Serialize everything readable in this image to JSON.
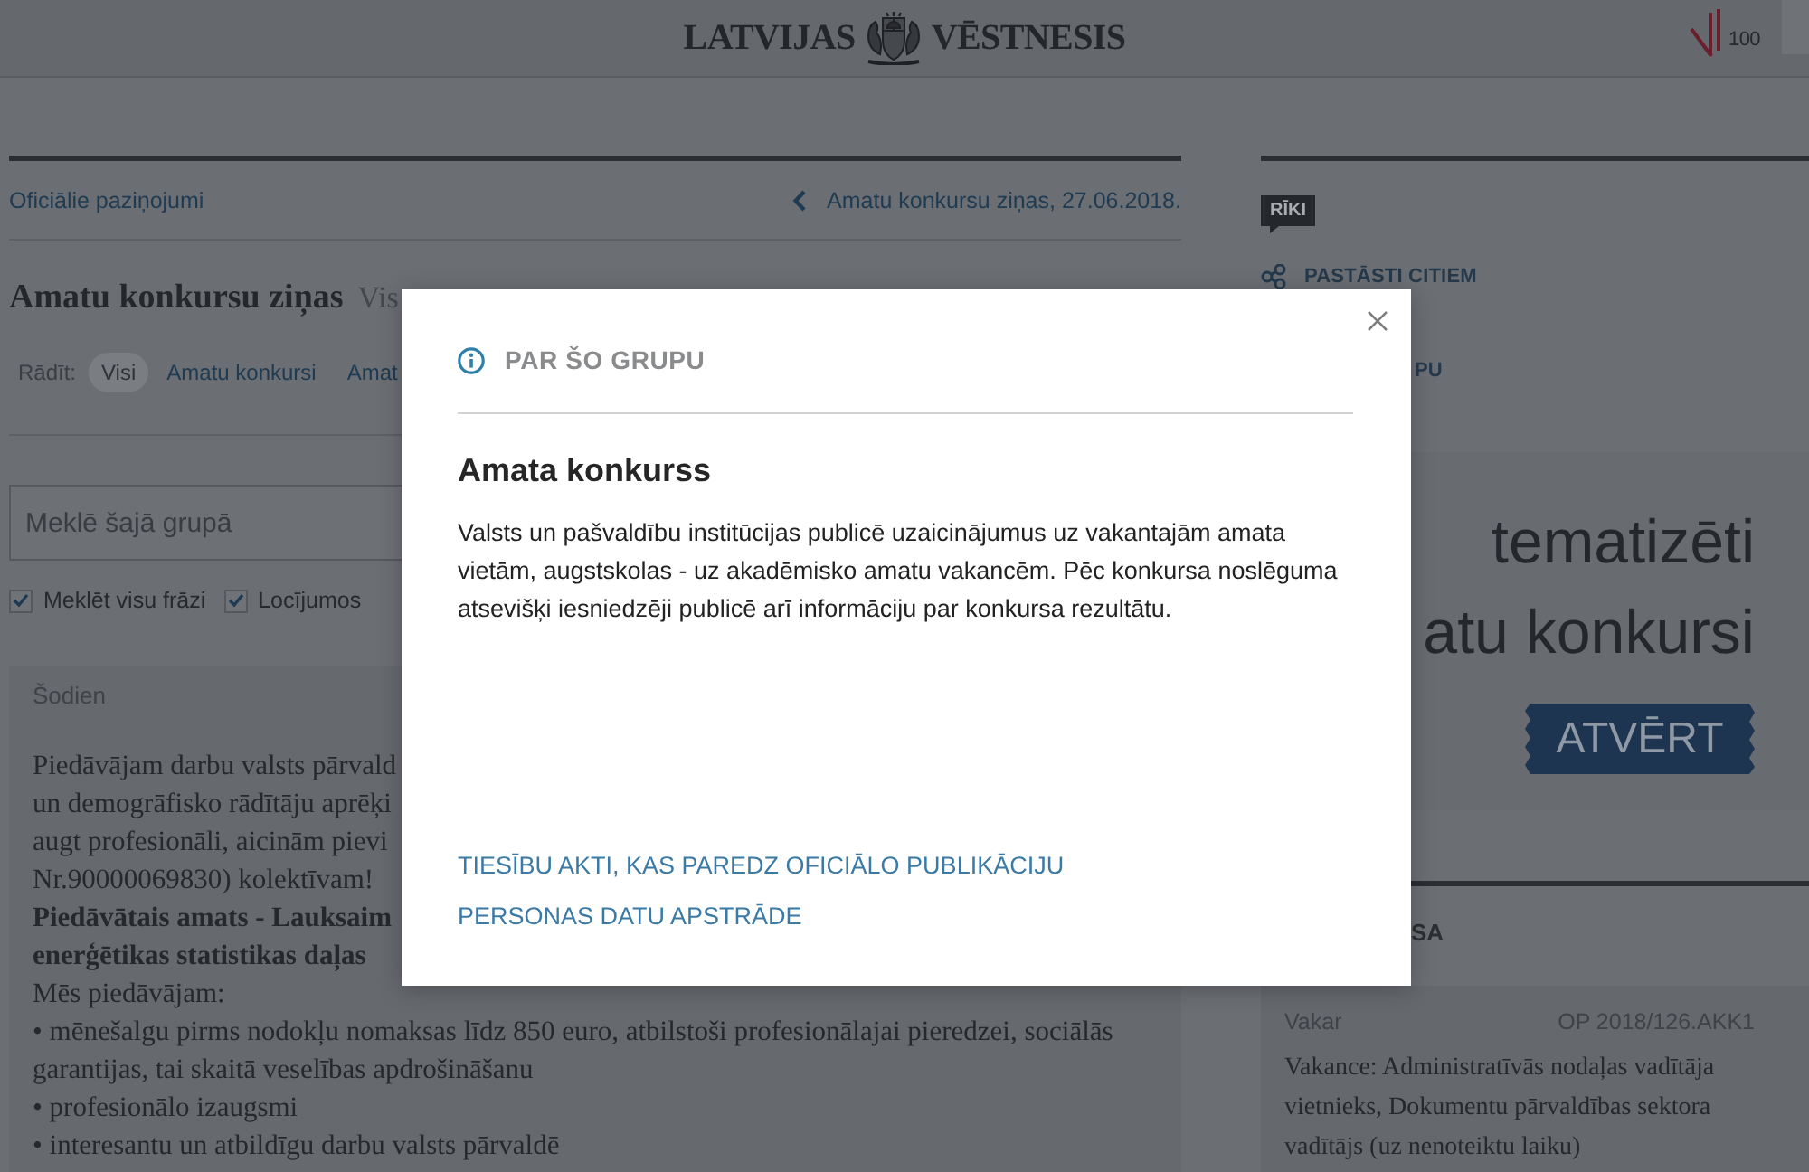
{
  "header": {
    "logo_left": "LATVIJAS",
    "logo_right": "VĒSTNESIS",
    "badge": "100"
  },
  "breadcrumb": {
    "section": "Oficiālie paziņojumi",
    "previous": "Amatu konkursu ziņas, 27.06.2018."
  },
  "group": {
    "title": "Amatu konkursu ziņas",
    "subtitle": "Vis"
  },
  "filter": {
    "label": "Rādīt:",
    "options": [
      {
        "label": "Visi",
        "selected": true
      },
      {
        "label": "Amatu konkursi",
        "selected": false
      },
      {
        "label": "Amat",
        "selected": false
      }
    ]
  },
  "search": {
    "placeholder": "Meklē šajā grupā",
    "options": [
      {
        "label": "Meklēt visu frāzi",
        "checked": true
      },
      {
        "label": "Locījumos",
        "checked": true
      }
    ]
  },
  "feed": {
    "date": "Šodien",
    "lines": [
      {
        "kind": "text",
        "text": "Piedāvājam darbu valsts pārvald"
      },
      {
        "kind": "text",
        "text": "un demogrāfisko rādītāju aprēķi"
      },
      {
        "kind": "text",
        "text": "augt profesionāli, aicinām pievi"
      },
      {
        "kind": "text",
        "text": "Nr.90000069830) kolektīvam!"
      },
      {
        "kind": "bold",
        "text": "Piedāvātais amats - Lauksaim"
      },
      {
        "kind": "bold",
        "text": "enerģētikas statistikas daļas"
      },
      {
        "kind": "text",
        "text": "Mēs piedāvājam:"
      },
      {
        "kind": "text",
        "text": "• mēnešalgu pirms nodokļu nomaksas līdz 850 euro, atbilstoši profesionālajai pieredzei, sociālās garantijas, tai skaitā veselības apdrošināšanu"
      },
      {
        "kind": "text",
        "text": "• profesionālo izaugsmi"
      },
      {
        "kind": "text",
        "text": "• interesantu un atbildīgu darbu valsts pārvaldē"
      }
    ]
  },
  "tools": {
    "title": "RĪKI",
    "items": [
      {
        "kind": "share",
        "label": "PASTĀSTI CITIEM"
      },
      {
        "kind": "partial",
        "label": "PU"
      }
    ]
  },
  "banner": {
    "lines": [
      "tematizēti",
      "atu konkursi"
    ],
    "button": "ATVĒRT"
  },
  "related": {
    "title": "SA",
    "items": [
      {
        "date": "Vakar",
        "code": "OP 2018/126.AKK1",
        "text": "Vakance: Administratīvās nodaļas vadītāja vietnieks, Dokumentu pārvaldības sektora vadītājs (uz nenoteiktu laiku)"
      }
    ]
  },
  "modal": {
    "title": "PAR ŠO GRUPU",
    "heading": "Amata konkurss",
    "body": "Valsts un pašvaldību institūcijas publicē uzaicinājumus uz vakantajām amata vietām, augstskolas - uz akadēmisko amatu vakancēm. Pēc konkursa noslēguma atsevišķi iesniedzēji publicē arī informāciju par konkursa rezultātu.",
    "links": [
      "TIESĪBU AKTI, KAS PAREDZ OFICIĀLO PUBLIKĀCIJU",
      "PERSONAS DATU APSTRĀDE"
    ]
  }
}
